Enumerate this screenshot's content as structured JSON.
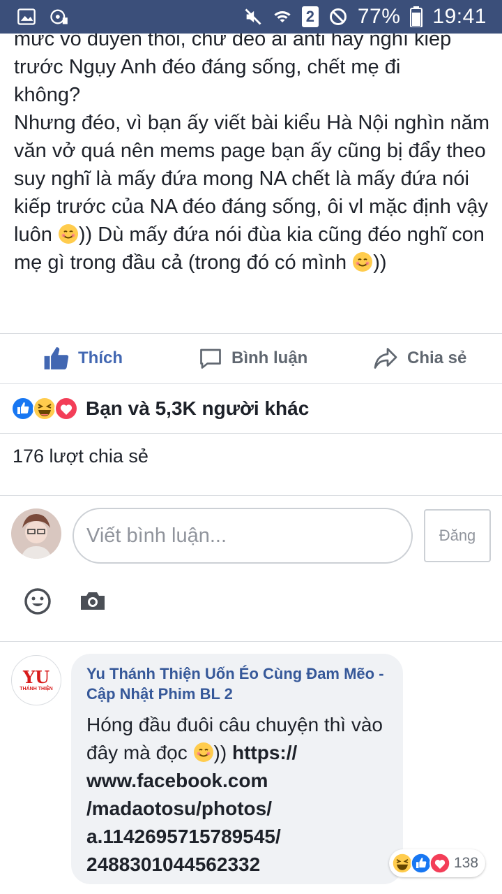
{
  "status_bar": {
    "battery": "77%",
    "time": "19:41",
    "sim_badge": "2",
    "icons": [
      "gallery-icon",
      "media-icon",
      "mute-icon",
      "wifi-icon",
      "sim-icon",
      "no-disturb-icon",
      "battery-icon"
    ]
  },
  "post": {
    "lines": [
      "mức vô duyên thôi, chứ đéo ai anti hay nghĩ kiếp",
      "trước Ngụy Anh đéo đáng sống, chết mẹ đi",
      "không?"
    ],
    "para2_before_emoji1": "Nhưng đéo, vì bạn ấy viết bài kiểu Hà Nội nghìn năm văn vở quá nên mems page bạn ấy cũng bị đẩy theo suy nghĩ là mấy đứa mong NA chết là mấy đứa nói kiếp trước của NA đéo đáng sống, ôi vl mặc định vậy luôn ",
    "para2_between": ")) Dù mấy đứa nói đùa kia cũng đéo nghĩ con mẹ gì trong đầu cả (trong đó có mình ",
    "para2_end": "))"
  },
  "actions": {
    "like_label": "Thích",
    "comment_label": "Bình luận",
    "share_label": "Chia sẻ"
  },
  "reactions": {
    "summary": "Bạn và 5,3K người khác",
    "types": [
      "like",
      "haha",
      "love"
    ]
  },
  "shares": "176 lượt chia sẻ",
  "composer": {
    "placeholder": "Viết bình luận...",
    "post_button": "Đăng",
    "tools": [
      "emoji-icon",
      "camera-icon"
    ]
  },
  "comment": {
    "avatar_text": "YU",
    "avatar_sub": "THÁNH THIỆN",
    "author": "Yu Thánh Thiện Uốn Éo Cùng Đam Mẽo - Cập Nhật Phim BL 2",
    "body_before": "Hóng đầu đuôi câu chuyện thì vào đây mà đọc ",
    "body_after": ")) ",
    "link": "https://www.facebook.com/madaotosu/photos/a.1142695715789545/2488301044562332",
    "link_lines": [
      "https://",
      "www.facebook.com",
      "/madaotosu/photos/",
      "a.1142695715789545/",
      "2488301044562332"
    ],
    "reaction_count": "138"
  },
  "colors": {
    "status_bar": "#3b4f7a",
    "facebook_blue": "#4267b2",
    "link": "#365899",
    "bubble": "#f0f2f5"
  }
}
